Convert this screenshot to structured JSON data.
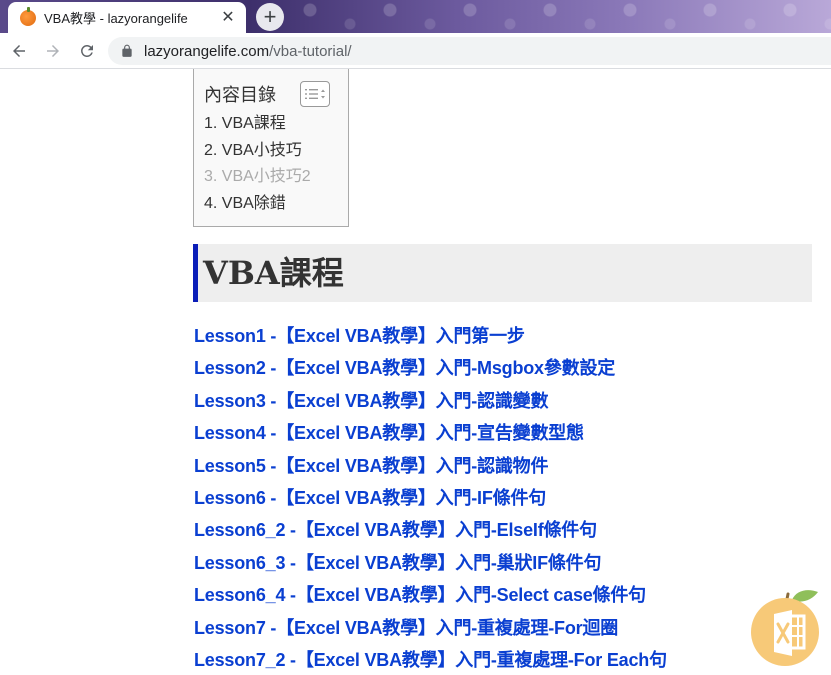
{
  "browser": {
    "tab_title": "VBA教學 - lazyorangelife",
    "close_glyph": "✕",
    "new_tab_glyph": "+",
    "url_host": "lazyorangelife.com",
    "url_path": "/vba-tutorial/"
  },
  "toc": {
    "title": "內容目錄",
    "items": [
      {
        "label": "1. VBA課程"
      },
      {
        "label": "2. VBA小技巧"
      },
      {
        "label": "3. VBA小技巧2"
      },
      {
        "label": "4. VBA除錯"
      }
    ]
  },
  "section": {
    "heading": "VBA課程"
  },
  "lessons": [
    {
      "label": "Lesson1 -【Excel VBA教學】入門第一步"
    },
    {
      "label": "Lesson2 -【Excel VBA教學】入門-Msgbox參數設定"
    },
    {
      "label": "Lesson3 -【Excel VBA教學】入門-認識變數"
    },
    {
      "label": "Lesson4 -【Excel VBA教學】入門-宣告變數型態"
    },
    {
      "label": "Lesson5 -【Excel VBA教學】入門-認識物件"
    },
    {
      "label": "Lesson6 -【Excel VBA教學】入門-IF條件句"
    },
    {
      "label": "Lesson6_2 -【Excel VBA教學】入門-ElseIf條件句"
    },
    {
      "label": "Lesson6_3 -【Excel VBA教學】入門-巢狀IF條件句"
    },
    {
      "label": "Lesson6_4 -【Excel VBA教學】入門-Select case條件句"
    },
    {
      "label": "Lesson7 -【Excel VBA教學】入門-重複處理-For迴圈"
    },
    {
      "label": "Lesson7_2 -【Excel VBA教學】入門-重複處理-For Each句"
    }
  ],
  "colors": {
    "link": "#0a3fd1",
    "heading_accent": "#0a1db8",
    "fab_orange": "#f7c978"
  },
  "icons": {
    "favicon": "orange-favicon-icon",
    "back": "arrow-left-icon",
    "forward": "arrow-right-icon",
    "reload": "reload-icon",
    "lock": "lock-icon",
    "toc_toggle": "list-icon",
    "fab": "excel-orange-icon"
  }
}
